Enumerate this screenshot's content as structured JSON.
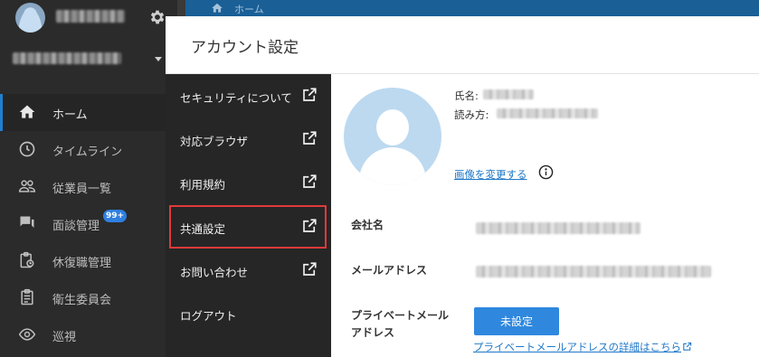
{
  "app": {
    "breadcrumb": "ホーム",
    "nav": [
      {
        "label": "ホーム",
        "icon": "home-icon",
        "active": true
      },
      {
        "label": "タイムライン",
        "icon": "clock-icon"
      },
      {
        "label": "従業員一覧",
        "icon": "people-icon"
      },
      {
        "label": "面談管理",
        "icon": "chat-icon",
        "badge": "99+"
      },
      {
        "label": "休復職管理",
        "icon": "clipboard-clock-icon"
      },
      {
        "label": "衛生委員会",
        "icon": "document-icon"
      },
      {
        "label": "巡視",
        "icon": "eye-icon"
      }
    ]
  },
  "modal": {
    "title": "アカウント設定",
    "menu": [
      {
        "label": "セキュリティについて",
        "external": true
      },
      {
        "label": "対応ブラウザ",
        "external": true
      },
      {
        "label": "利用規約",
        "external": true
      },
      {
        "label": "共通設定",
        "external": true,
        "selected": true
      },
      {
        "label": "お問い合わせ",
        "external": true
      },
      {
        "label": "ログアウト",
        "external": false
      }
    ],
    "profile": {
      "name_label": "氏名:",
      "reading_label": "読み方:",
      "change_image_link": "画像を変更する"
    },
    "fields": {
      "company_label": "会社名",
      "email_label": "メールアドレス",
      "private_email_label": "プライベートメールアドレス",
      "private_email_button": "未設定",
      "private_email_detail_link": "プライベートメールアドレスの詳細はこちら"
    }
  },
  "colors": {
    "accent": "#2f88de",
    "link": "#1f78c8",
    "highlight_border": "#e03a3a",
    "sidebar_bg": "#2b2b2b",
    "menu_bg": "#262626"
  }
}
